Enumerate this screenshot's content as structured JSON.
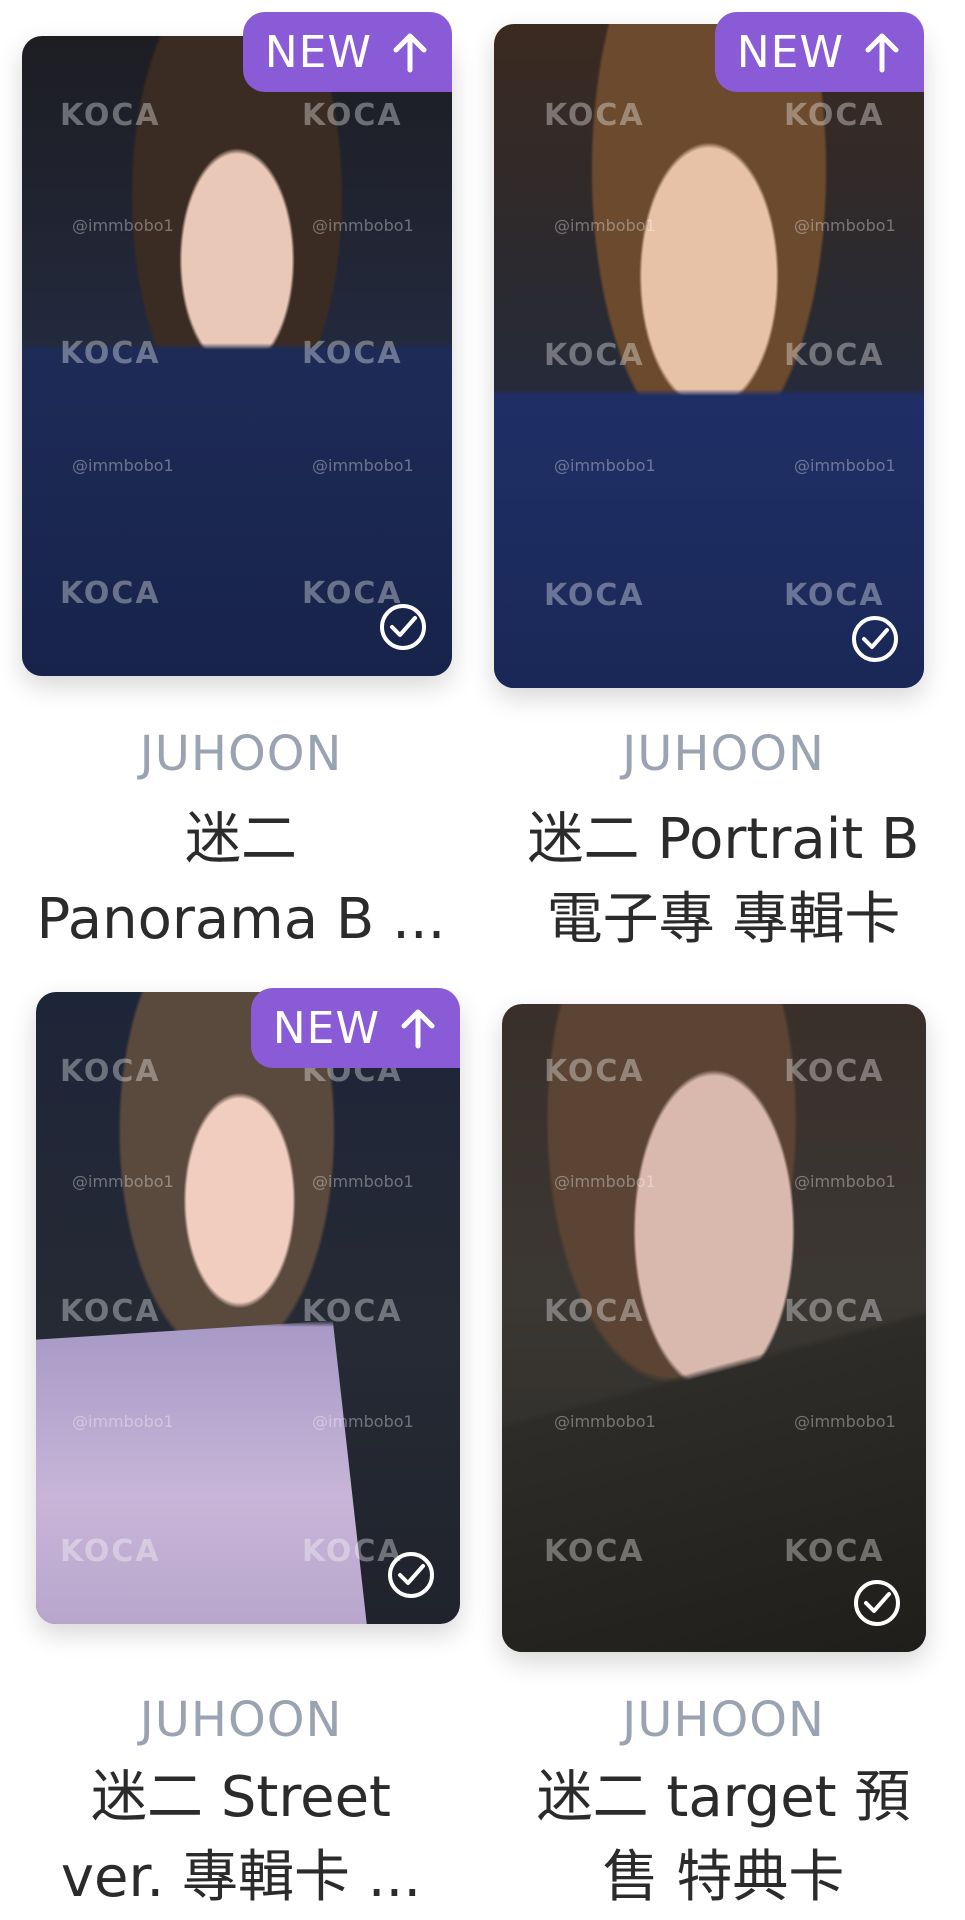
{
  "badge": {
    "label": "NEW"
  },
  "watermark": {
    "brand": "KOCA",
    "handle": "@immbobo1"
  },
  "cards": [
    {
      "member": "JUHOON",
      "title": "迷二\nPanorama B ...",
      "is_new": true,
      "checked": true
    },
    {
      "member": "JUHOON",
      "title": "迷二 Portrait B\n電子專 專輯卡",
      "is_new": true,
      "checked": true
    },
    {
      "member": "JUHOON",
      "title": "迷二 Street\nver. 專輯卡 ...",
      "is_new": true,
      "checked": true
    },
    {
      "member": "JUHOON",
      "title": "迷二 target 預\n售 特典卡",
      "is_new": false,
      "checked": true
    }
  ],
  "colors": {
    "badge_bg": "#8a5bd6",
    "member_text": "#9aa3b2",
    "title_text": "#2b2b2b"
  }
}
